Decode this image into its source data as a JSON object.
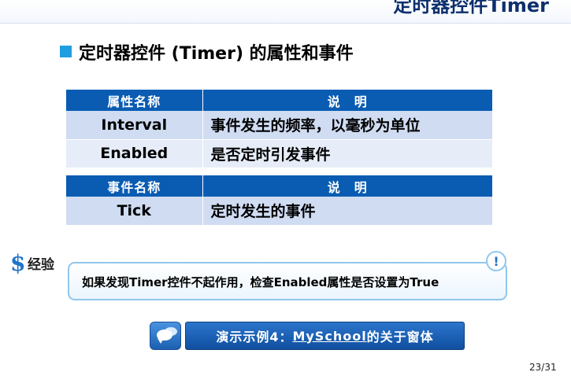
{
  "slide": {
    "top_title": "定时器控件Timer",
    "heading": "定时器控件 (Timer) 的属性和事件",
    "properties_table": {
      "headers": [
        "属性名称",
        "说　明"
      ],
      "rows": [
        [
          "Interval",
          "事件发生的频率，以毫秒为单位"
        ],
        [
          "Enabled",
          "是否定时引发事件"
        ]
      ]
    },
    "events_table": {
      "headers": [
        "事件名称",
        "说　明"
      ],
      "rows": [
        [
          "Tick",
          "定时发生的事件"
        ]
      ]
    },
    "experience": {
      "icon": "$",
      "label": "经验",
      "badge": "!",
      "tip": "如果发现Timer控件不起作用，检查Enabled属性是否设置为True"
    },
    "demo": {
      "prefix": "演示示例4：",
      "link": "MySchool",
      "suffix": "的关于窗体"
    },
    "page_number": "23/31"
  },
  "colors": {
    "header_blue": "#0a5cb2",
    "row_light": "#cfdcf2",
    "row_lighter": "#e6edf8",
    "accent": "#1e9ee0"
  }
}
